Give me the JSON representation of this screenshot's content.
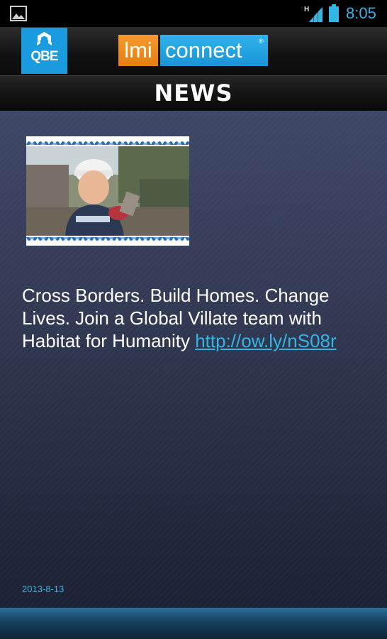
{
  "status_bar": {
    "time": "8:05",
    "network_label": "H",
    "icons": [
      "image-icon",
      "signal-icon",
      "battery-icon"
    ],
    "accent_color": "#33b5e5"
  },
  "header": {
    "qbe_logo_text": "QBE",
    "lmi_logo_left": "lmi",
    "lmi_logo_right": "connect",
    "registered_mark": "®"
  },
  "title_bar": {
    "title": "NEWS"
  },
  "news": {
    "text": "Cross Borders. Build Homes. Change Lives. Join a Global Villate team with Habitat for Humanity",
    "link_text": "http://ow.ly/nS08r",
    "date": "2013-8-13",
    "thumbnail": "news-photo"
  },
  "colors": {
    "accent": "#33b5e5",
    "qbe_blue": "#1a9be0",
    "lmi_orange": "#f49a2c",
    "connect_blue": "#2fb3ec",
    "content_bg": "#333b56"
  }
}
